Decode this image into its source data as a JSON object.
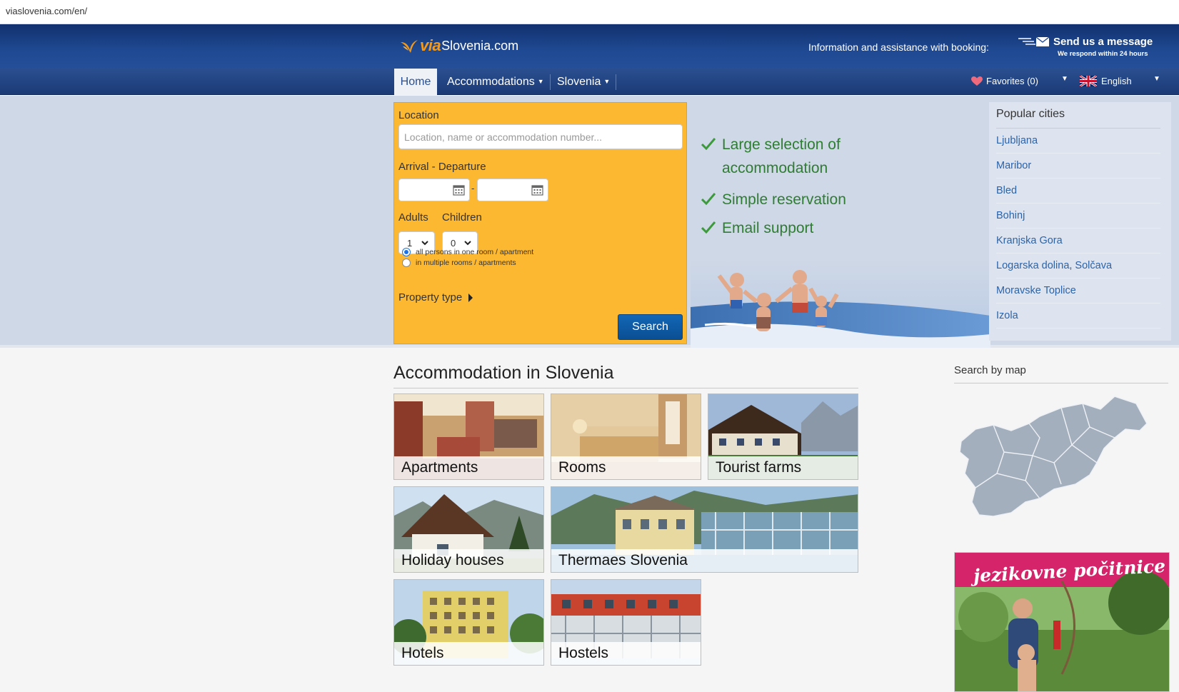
{
  "browser": {
    "url": "viaslovenia.com/en/"
  },
  "header": {
    "logo_via": "via",
    "logo_rest": "Slovenia.com",
    "info_text": "Information and assistance with booking:",
    "message_title": "Send us a message",
    "message_sub": "We respond within 24 hours"
  },
  "nav": {
    "home": "Home",
    "accommodations": "Accommodations",
    "slovenia": "Slovenia",
    "favorites": "Favorites (0)",
    "language": "English"
  },
  "search": {
    "location_label": "Location",
    "location_placeholder": "Location, name or accommodation number...",
    "dates_label": "Arrival - Departure",
    "dates_separator": "-",
    "adults_label": "Adults",
    "adults_value": "1",
    "children_label": "Children",
    "children_value": "0",
    "radio_one": "all persons in one room / apartment",
    "radio_multiple": "in multiple rooms / apartments",
    "property_type": "Property type",
    "button": "Search"
  },
  "features": [
    {
      "line1": "Large selection of",
      "line2": "accommodation"
    },
    {
      "line1": "Simple reservation"
    },
    {
      "line1": "Email support"
    }
  ],
  "popular": {
    "title": "Popular cities",
    "cities": [
      "Ljubljana",
      "Maribor",
      "Bled",
      "Bohinj",
      "Kranjska Gora",
      "Logarska dolina, Solčava",
      "Moravske Toplice",
      "Izola"
    ]
  },
  "main": {
    "title": "Accommodation in Slovenia",
    "tiles": [
      "Apartments",
      "Rooms",
      "Tourist farms",
      "Holiday houses",
      "Thermaes Slovenia",
      "Hotels",
      "Hostels"
    ]
  },
  "sidebar": {
    "map_title": "Search by map",
    "ad_title": "jezikovne počitnice"
  }
}
